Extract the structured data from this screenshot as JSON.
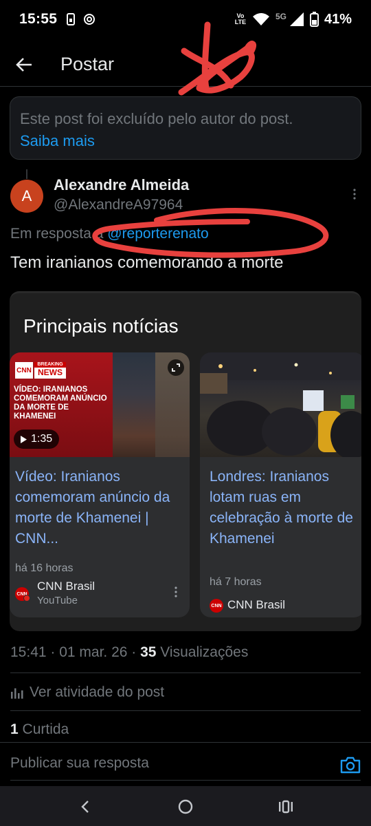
{
  "status_bar": {
    "time": "15:55",
    "volte": "Vo LTE",
    "network": "5G",
    "battery": "41%"
  },
  "header": {
    "title": "Postar"
  },
  "deleted_notice": {
    "message": "Este post foi excluído pelo autor do post.",
    "link": "Saiba mais"
  },
  "post": {
    "avatar_letter": "A",
    "author_name": "Alexandre Almeida",
    "author_handle": "@AlexandreA97964",
    "reply_prefix": "Em resposta a ",
    "reply_mention": "@reporterenato",
    "text": "Tem iranianos comemorando a morte"
  },
  "news_card": {
    "title": "Principais notícias",
    "items": [
      {
        "logo": "CNN",
        "badge_top": "BREAKING",
        "badge_bottom": "NEWS",
        "image_caption": "VÍDEO: IRANIANOS COMEMORAM ANÚNCIO DA MORTE DE KHAMENEI",
        "duration": "1:35",
        "headline": "Vídeo: Iranianos comemoram anúncio da morte de Khamenei | CNN...",
        "time": "há 16 horas",
        "source": "CNN Brasil",
        "platform": "YouTube"
      },
      {
        "headline": "Londres: Iranianos lotam ruas em celebração à morte de Khamenei",
        "time": "há 7 horas",
        "source": "CNN Brasil"
      }
    ]
  },
  "meta": {
    "time_date": "15:41 · 01 mar. 26 · ",
    "views_count": "35",
    "views_label": " Visualizações",
    "activity": "Ver atividade do post",
    "likes_count": "1",
    "likes_label": " Curtida"
  },
  "reply": {
    "placeholder": "Publicar sua resposta"
  },
  "colors": {
    "accent": "#1d9bf0",
    "annotation": "#e8413e",
    "avatar": "#c8421e"
  }
}
